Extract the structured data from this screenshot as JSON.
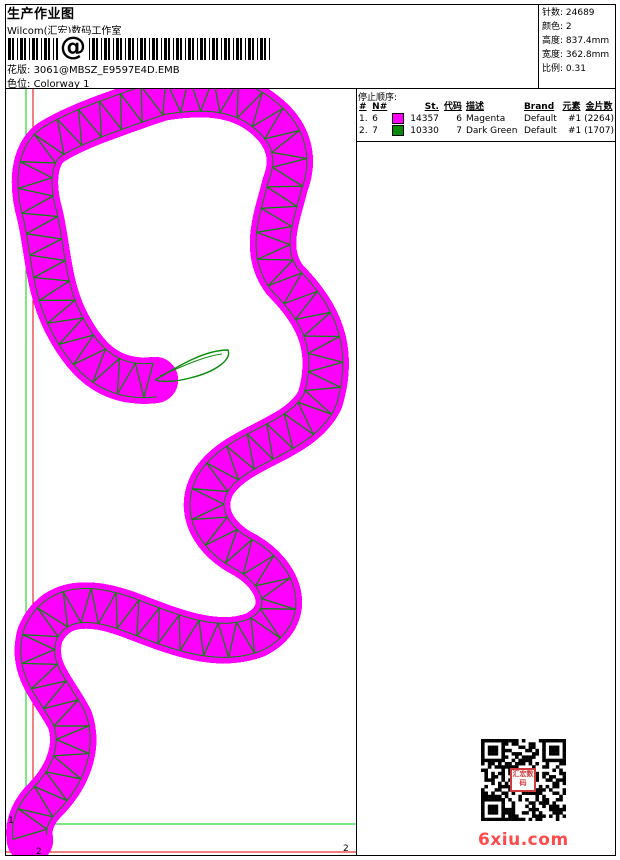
{
  "header": {
    "title": "生产作业图",
    "company": "Wilcom(汇宏)数码工作室",
    "barcode_symbol": "@",
    "design_label": "花版:",
    "design_value": "3061@MBSZ_E9597E4D.EMB",
    "colorway_label": "色位:",
    "colorway_value": "Colorway 1"
  },
  "stats": {
    "stitches": "针数: 24689",
    "colors": "颜色: 2",
    "height": "高度: 837.4mm",
    "width": "宽度: 362.8mm",
    "scale": "比例: 0.31"
  },
  "stop_sequence": {
    "title": "停止顺序:",
    "columns": [
      "#",
      "N#",
      "St.",
      "代码",
      "描述",
      "Brand",
      "元素",
      "金片数"
    ],
    "rows": [
      {
        "num": "1.",
        "needle": "6",
        "swatch": "#ff00ff",
        "stitches": "14357",
        "code": "6",
        "desc": "Magenta",
        "brand": "Default",
        "element": "#1 (2264)"
      },
      {
        "num": "2.",
        "needle": "7",
        "swatch": "#0a8a0a",
        "stitches": "10330",
        "code": "7",
        "desc": "Dark Green",
        "brand": "Default",
        "element": "#1 (1707)"
      }
    ]
  },
  "markers": {
    "start_left": "1",
    "start_bottom": "2",
    "end_right": "2"
  },
  "colors": {
    "fill": "#ff00ff",
    "outline": "#0a8a0a",
    "guide_green": "#00cc00",
    "guide_red": "#e00000"
  },
  "watermark": "6xiu.com",
  "seal": "汇宏数码"
}
